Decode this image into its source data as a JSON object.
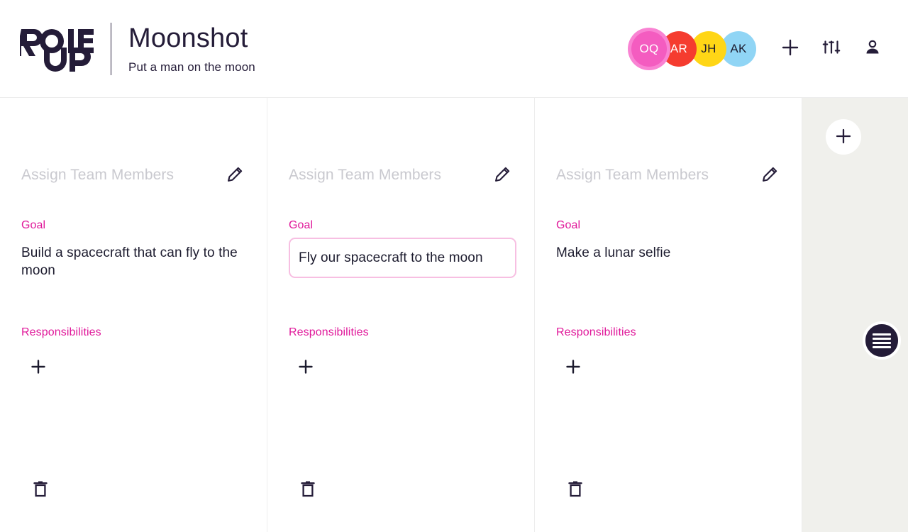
{
  "header": {
    "logo_alt": "RoleUp",
    "logo_line1": "ROLE",
    "logo_line2": "UP",
    "project_title": "Moonshot",
    "project_subtitle": "Put a man on the moon",
    "members": [
      {
        "initials": "OQ",
        "bg": "#f45cc0",
        "fg": "#ffffff",
        "ring": "#f983d3",
        "selected": true
      },
      {
        "initials": "AR",
        "bg": "#f53c2f",
        "fg": "#ffffff",
        "ring": "",
        "selected": false
      },
      {
        "initials": "JH",
        "bg": "#ffd616",
        "fg": "#1c1b2e",
        "ring": "",
        "selected": false
      },
      {
        "initials": "AK",
        "bg": "#90d5f5",
        "fg": "#1c1b2e",
        "ring": "",
        "selected": false
      }
    ],
    "actions": {
      "add_member": "add-member-icon",
      "filters": "sliders-icon",
      "account": "person-icon"
    }
  },
  "board": {
    "assign_placeholder": "Assign Team Members",
    "goal_label": "Goal",
    "responsibilities_label": "Responsibilities",
    "columns": [
      {
        "assign_placeholder": "Assign Team Members",
        "goal_label": "Goal",
        "goal_value": "Build a spacecraft that can fly to the moon",
        "goal_editing": false,
        "responsibilities_label": "Responsibilities",
        "responsibilities": []
      },
      {
        "assign_placeholder": "Assign Team Members",
        "goal_label": "Goal",
        "goal_value": "Fly our spacecraft to the moon",
        "goal_editing": true,
        "responsibilities_label": "Responsibilities",
        "responsibilities": []
      },
      {
        "assign_placeholder": "Assign Team Members",
        "goal_label": "Goal",
        "goal_value": "Make a lunar selfie",
        "goal_editing": false,
        "responsibilities_label": "Responsibilities",
        "responsibilities": []
      }
    ]
  },
  "rail": {
    "add_column_icon": "plus-icon",
    "menu_icon": "hamburger-menu-icon"
  },
  "colors": {
    "accent_pink": "#e0189a",
    "dark_navy": "#241c38",
    "placeholder_gray": "#c9c9cf",
    "rail_bg": "#f0f0ec",
    "input_border": "#f7bfe2"
  }
}
